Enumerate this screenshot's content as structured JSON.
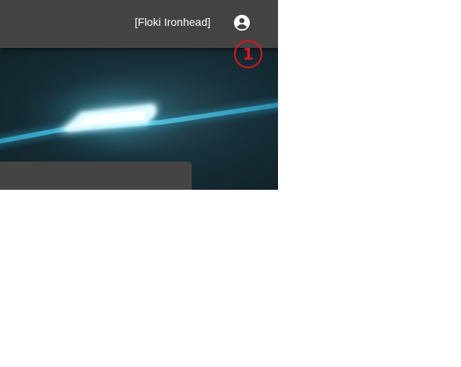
{
  "header": {
    "user_name": "[Floki Ironhead]",
    "account_icon": "account-circle-icon"
  },
  "annotation": {
    "marker_label": "1",
    "marker_color": "#e0131c"
  },
  "colors": {
    "header_bg": "#434343",
    "panel_bg": "#444444",
    "hero_glow": "#7fe6ff"
  }
}
